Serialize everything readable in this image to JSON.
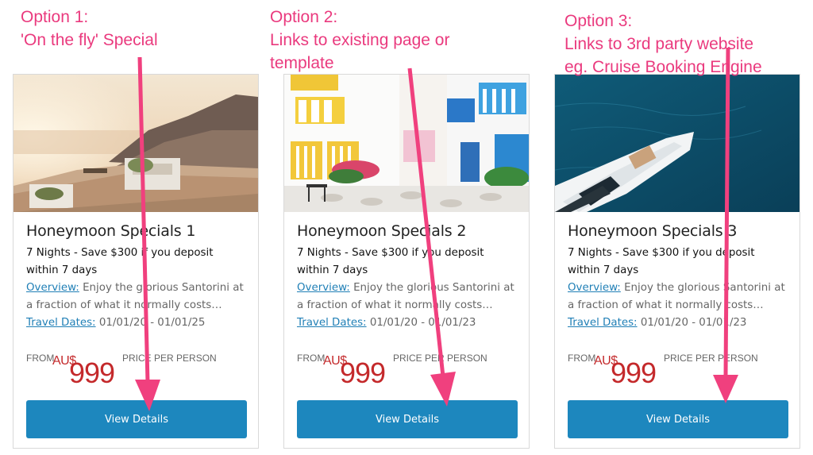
{
  "annotations": [
    {
      "line1": "Option 1:",
      "line2": "'On the fly' Special",
      "line3": ""
    },
    {
      "line1": "Option 2:",
      "line2": "Links to existing page or",
      "line3": "template"
    },
    {
      "line1": "Option 3:",
      "line2": "Links to 3rd party website",
      "line3": "eg. Cruise Booking Engine"
    }
  ],
  "cards": [
    {
      "title": "Honeymoon Specials 1",
      "desc": "7 Nights - Save $300 if you deposit within 7 days",
      "overview_label": "Overview:",
      "overview_text": " Enjoy the glorious Santorini at",
      "overview_text2": "a fraction of what it normally costs…",
      "dates_label": "Travel Dates:",
      "dates_value": " 01/01/20 - 01/01/25",
      "from": "FROM",
      "currency": "AU$",
      "amount": "999",
      "per_person": "PRICE PER PERSON",
      "button": "View Details"
    },
    {
      "title": "Honeymoon Specials 2",
      "desc": "7 Nights - Save $300 if you deposit within 7 days",
      "overview_label": "Overview:",
      "overview_text": " Enjoy the glorious Santorini at",
      "overview_text2": "a fraction of what it normally costs…",
      "dates_label": "Travel Dates:",
      "dates_value": " 01/01/20 - 01/01/23",
      "from": "FROM",
      "currency": "AU$",
      "amount": "999",
      "per_person": "PRICE PER PERSON",
      "button": "View Details"
    },
    {
      "title": "Honeymoon Specials 3",
      "desc": "7 Nights - Save $300 if you deposit within 7 days",
      "overview_label": "Overview:",
      "overview_text": " Enjoy the glorious Santorini at",
      "overview_text2": "a fraction of what it normally costs…",
      "dates_label": "Travel Dates:",
      "dates_value": " 01/01/20 - 01/01/23",
      "from": "FROM",
      "currency": "AU$",
      "amount": "999",
      "per_person": "PRICE PER PERSON",
      "button": "View Details"
    }
  ],
  "colors": {
    "annotation": "#ea3a7e",
    "arrow": "#f0407e",
    "button": "#1d87be",
    "price": "#c4292b",
    "link": "#1f7fb6"
  },
  "images": [
    "santorini-sunset-terrace-photo",
    "colorful-greek-village-street-photo",
    "yacht-on-ocean-aerial-photo"
  ]
}
